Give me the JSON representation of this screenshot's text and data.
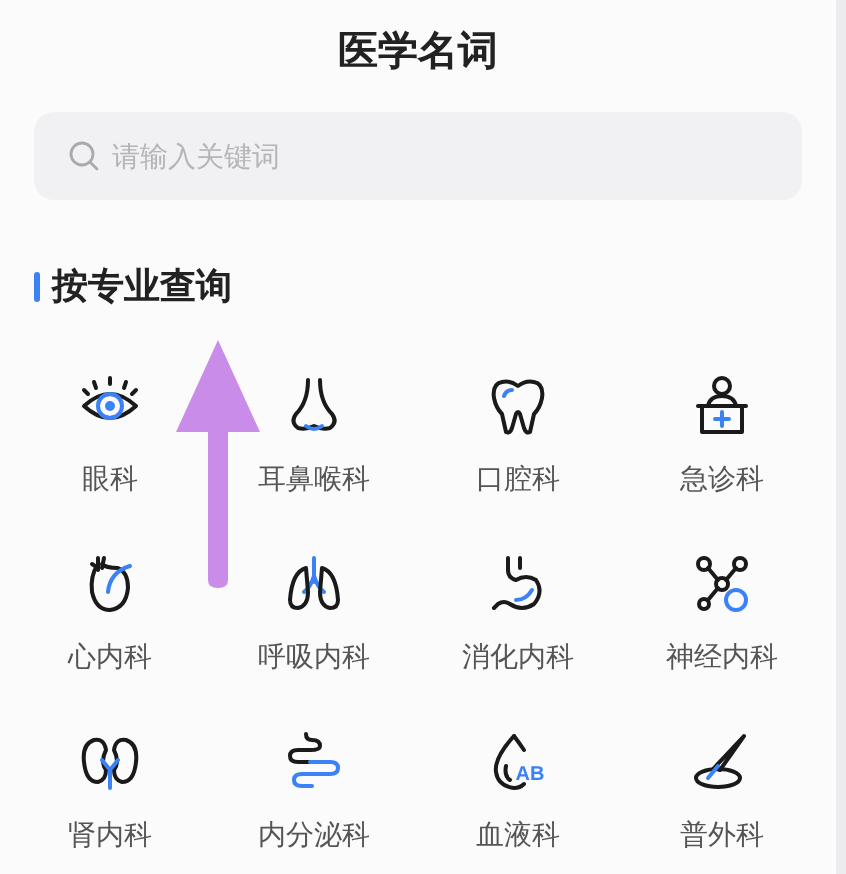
{
  "header": {
    "title": "医学名词"
  },
  "search": {
    "placeholder": "请输入关键词"
  },
  "section": {
    "title": "按专业查询"
  },
  "departments": [
    {
      "kind": "eye",
      "label": "眼科"
    },
    {
      "kind": "nose",
      "label": "耳鼻喉科"
    },
    {
      "kind": "tooth",
      "label": "口腔科"
    },
    {
      "kind": "emergency",
      "label": "急诊科"
    },
    {
      "kind": "heart",
      "label": "心内科"
    },
    {
      "kind": "lungs",
      "label": "呼吸内科"
    },
    {
      "kind": "stomach",
      "label": "消化内科"
    },
    {
      "kind": "neuron",
      "label": "神经内科"
    },
    {
      "kind": "kidneys",
      "label": "肾内科"
    },
    {
      "kind": "intestine",
      "label": "内分泌科"
    },
    {
      "kind": "blood",
      "label": "血液科",
      "badge": "AB"
    },
    {
      "kind": "scalpel",
      "label": "普外科"
    }
  ]
}
